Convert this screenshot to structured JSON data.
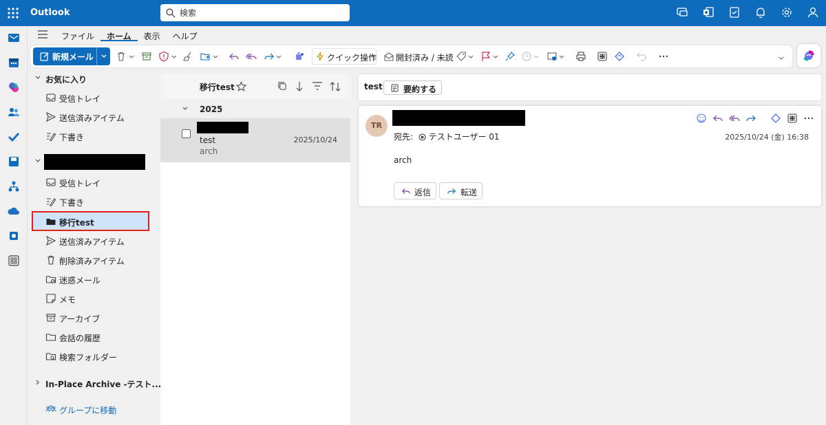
{
  "app": {
    "title": "Outlook"
  },
  "search": {
    "placeholder": "検索"
  },
  "colors": {
    "brand": "#0f6cbd",
    "selected": "#cfe4fa",
    "highlight_border": "#e0201a"
  },
  "ribbon_tabs": [
    {
      "label": "ファイル"
    },
    {
      "label": "ホーム"
    },
    {
      "label": "表示"
    },
    {
      "label": "ヘルプ"
    }
  ],
  "ribbon": {
    "new_mail": "新規メール",
    "quick_steps": "クイック操作",
    "read_unread": "開封済み / 未読"
  },
  "folders": {
    "favorites_header": "お気に入り",
    "favorites": [
      {
        "label": "受信トレイ"
      },
      {
        "label": "送信済みアイテム"
      },
      {
        "label": "下書き"
      }
    ],
    "account_items": [
      {
        "label": "受信トレイ"
      },
      {
        "label": "下書き"
      },
      {
        "label": "移行test"
      },
      {
        "label": "送信済みアイテム"
      },
      {
        "label": "削除済みアイテム"
      },
      {
        "label": "迷惑メール"
      },
      {
        "label": "メモ"
      },
      {
        "label": "アーカイブ"
      },
      {
        "label": "会話の履歴"
      },
      {
        "label": "検索フォルダー"
      }
    ],
    "archive_header": "In-Place Archive -テスト...",
    "go_to_groups": "グループに移動"
  },
  "list": {
    "title": "移行test",
    "group": "2025",
    "items": [
      {
        "subject": "test",
        "preview": "arch",
        "date": "2025/10/24"
      }
    ]
  },
  "reading": {
    "subject": "test",
    "summarize": "要約する",
    "avatar_initials": "TR",
    "to_label": "宛先:",
    "to_value": "テストユーザー 01",
    "date": "2025/10/24 (金) 16:38",
    "body": "arch",
    "reply": "返信",
    "forward": "転送"
  }
}
